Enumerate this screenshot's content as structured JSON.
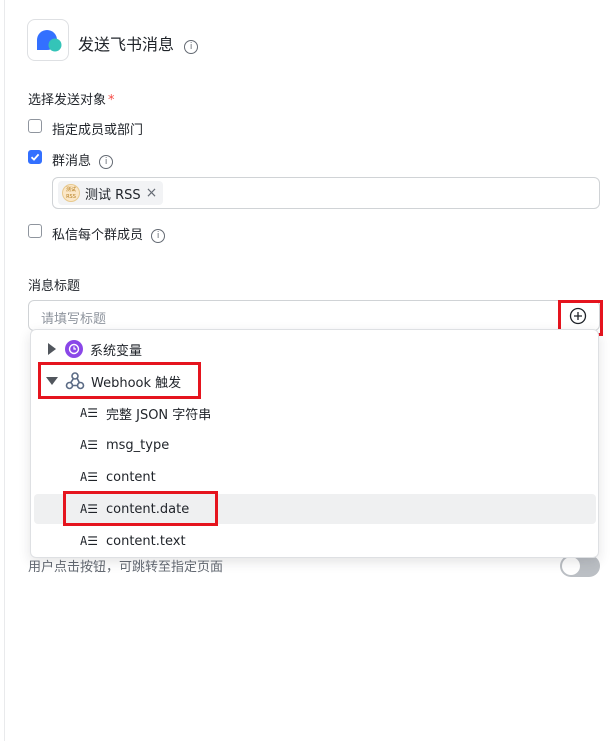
{
  "header": {
    "title": "发送飞书消息",
    "info_icon": "info-circle-icon"
  },
  "recipients": {
    "label": "选择发送对象",
    "required_mark": "*",
    "options": [
      {
        "label": "指定成员或部门",
        "checked": false
      },
      {
        "label": "群消息",
        "checked": true
      },
      {
        "label": "私信每个群成员",
        "checked": false
      }
    ],
    "selected_group": {
      "name": "测试 RSS",
      "badge_top": "测试",
      "badge_bottom": "RSS",
      "remove": "×"
    }
  },
  "message_title": {
    "label": "消息标题",
    "placeholder": "请填写标题",
    "add_icon": "plus-circle-icon"
  },
  "variable_dropdown": {
    "groups": [
      {
        "label": "系统变量",
        "expanded": false,
        "icon": "clock-icon"
      },
      {
        "label": "Webhook 触发",
        "expanded": true,
        "icon": "webhook-icon"
      }
    ],
    "fields": [
      {
        "label": "完整 JSON 字符串",
        "icon": "text-type-icon"
      },
      {
        "label": "msg_type",
        "icon": "text-type-icon"
      },
      {
        "label": "content",
        "icon": "text-type-icon"
      },
      {
        "label": "content.date",
        "icon": "text-type-icon",
        "highlighted": true
      },
      {
        "label": "content.text",
        "icon": "text-type-icon"
      }
    ],
    "field_type_glyph": "A☰"
  },
  "button_link": {
    "hint": "用户点击按钮，可跳转至指定页面",
    "enabled": false
  },
  "colors": {
    "accent": "#3370ff",
    "annotation": "#e5141e",
    "app_icon_blue": "#3370ff",
    "app_icon_teal": "#34c4b8"
  }
}
